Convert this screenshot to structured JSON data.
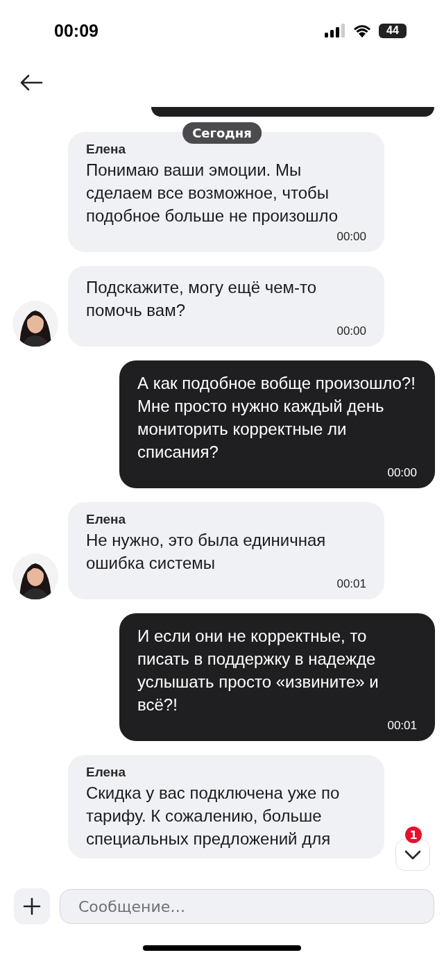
{
  "status_bar": {
    "time": "00:09",
    "battery": "44"
  },
  "date_chip": "Сегодня",
  "messages": [
    {
      "kind": "incoming",
      "sender": "Елена",
      "text": "Понимаю ваши эмоции. Мы сделаем все возможное, чтобы подобное больше не произошло",
      "time": "00:00",
      "avatar": false
    },
    {
      "kind": "incoming",
      "text": "Подскажите, могу ещё чем-то помочь вам?",
      "time": "00:00",
      "avatar": true
    },
    {
      "kind": "outgoing",
      "text": "А как подобное вобще произошло?!\nМне просто нужно каждый день мониторить корректные ли списания?",
      "time": "00:00"
    },
    {
      "kind": "incoming",
      "sender": "Елена",
      "text": "Не нужно, это была единичная ошибка системы",
      "time": "00:01",
      "avatar": true
    },
    {
      "kind": "outgoing",
      "text": "И если они не корректные, то писать в поддержку в надежде услышать просто «извините» и всё?!",
      "time": "00:01"
    },
    {
      "kind": "incoming",
      "sender": "Елена",
      "text": "Скидка у вас подключена уже по тарифу. К сожалению, больше специальных предложений для"
    }
  ],
  "scroll_button": {
    "badge": "1"
  },
  "composer": {
    "placeholder": "Сообщение…"
  }
}
